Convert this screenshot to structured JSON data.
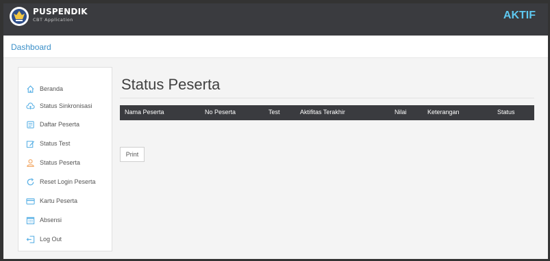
{
  "header": {
    "brand_name": "PUSPENDIK",
    "brand_subtitle": "CBT Application",
    "status": "AKTIF",
    "status_color": "#5ec8f0"
  },
  "breadcrumb": {
    "label": "Dashboard"
  },
  "sidebar": {
    "items": [
      {
        "label": "Beranda",
        "icon": "home-icon"
      },
      {
        "label": "Status Sinkronisasi",
        "icon": "cloud-icon"
      },
      {
        "label": "Daftar Peserta",
        "icon": "document-icon"
      },
      {
        "label": "Status Test",
        "icon": "edit-icon"
      },
      {
        "label": "Status Peserta",
        "icon": "user-icon"
      },
      {
        "label": "Reset Login Peserta",
        "icon": "refresh-icon"
      },
      {
        "label": "Kartu Peserta",
        "icon": "card-icon"
      },
      {
        "label": "Absensi",
        "icon": "calendar-icon"
      },
      {
        "label": "Log Out",
        "icon": "logout-icon"
      }
    ],
    "icon_color": "#5fb3e6"
  },
  "main": {
    "title": "Status Peserta",
    "columns": [
      "Nama Peserta",
      "No Peserta",
      "Test",
      "Aktifitas Terakhir",
      "Nilai",
      "Keterangan",
      "Status"
    ],
    "rows": [],
    "print_label": "Print"
  }
}
